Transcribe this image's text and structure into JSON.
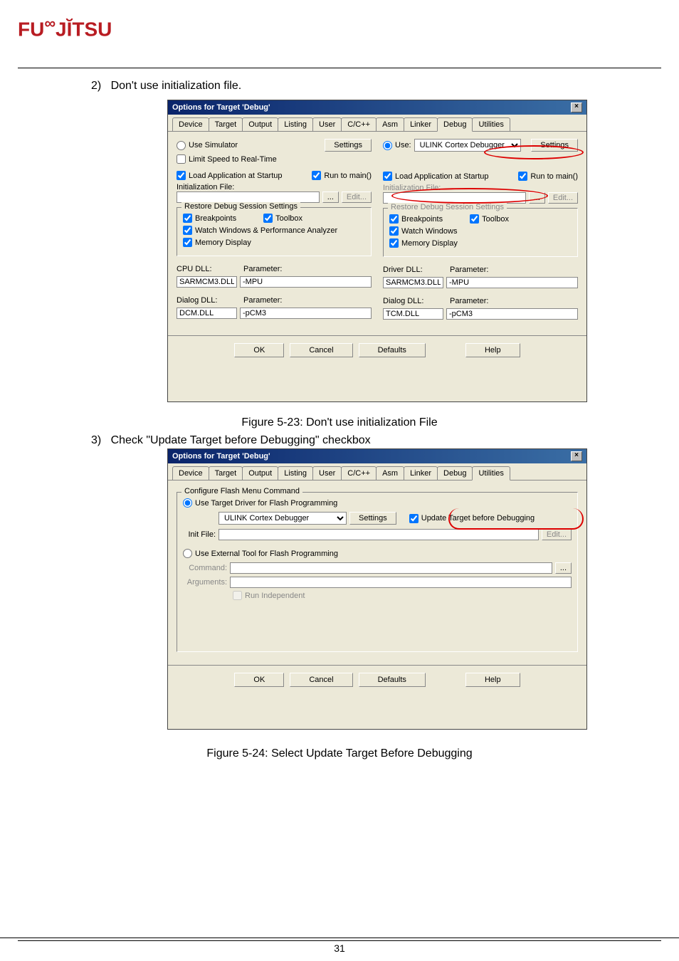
{
  "logo": "FUJITSU",
  "step2": {
    "num": "2)",
    "text": "Don't use initialization file."
  },
  "caption1": "Figure 5-23:  Don't use initialization File",
  "step3": {
    "num": "3)",
    "text": "Check \"Update Target before Debugging\" checkbox"
  },
  "caption2": "Figure 5-24:  Select Update Target Before Debugging",
  "page_number": "31",
  "dialog1": {
    "title": "Options for Target 'Debug'",
    "tabs": [
      "Device",
      "Target",
      "Output",
      "Listing",
      "User",
      "C/C++",
      "Asm",
      "Linker",
      "Debug",
      "Utilities"
    ],
    "active_tab": 8,
    "left": {
      "use_simulator": "Use Simulator",
      "settings": "Settings",
      "limit_speed": "Limit Speed to Real-Time",
      "load_app": "Load Application at Startup",
      "run_to_main": "Run to main()",
      "init_file_label": "Initialization File:",
      "init_file_value": "",
      "browse": "...",
      "edit": "Edit...",
      "restore_legend": "Restore Debug Session Settings",
      "breakpoints": "Breakpoints",
      "toolbox": "Toolbox",
      "watch": "Watch Windows & Performance Analyzer",
      "memory": "Memory Display",
      "cpu_dll_label": "CPU DLL:",
      "cpu_dll_value": "SARMCM3.DLL",
      "param_label": "Parameter:",
      "cpu_param_value": "-MPU",
      "dialog_dll_label": "Dialog DLL:",
      "dialog_dll_value": "DCM.DLL",
      "dialog_param_value": "-pCM3"
    },
    "right": {
      "use": "Use:",
      "debugger": "ULINK Cortex Debugger",
      "settings": "Settings",
      "load_app": "Load Application at Startup",
      "run_to_main": "Run to main()",
      "init_file_label": "Initialization File:",
      "init_file_value": "",
      "browse": "...",
      "edit": "Edit...",
      "restore_legend": "Restore Debug Session Settings",
      "breakpoints": "Breakpoints",
      "toolbox": "Toolbox",
      "watch": "Watch Windows",
      "memory": "Memory Display",
      "driver_dll_label": "Driver DLL:",
      "driver_dll_value": "SARMCM3.DLL",
      "param_label": "Parameter:",
      "driver_param_value": "-MPU",
      "dialog_dll_label": "Dialog DLL:",
      "dialog_dll_value": "TCM.DLL",
      "dialog_param_value": "-pCM3"
    },
    "buttons": {
      "ok": "OK",
      "cancel": "Cancel",
      "defaults": "Defaults",
      "help": "Help"
    }
  },
  "dialog2": {
    "title": "Options for Target 'Debug'",
    "tabs": [
      "Device",
      "Target",
      "Output",
      "Listing",
      "User",
      "C/C++",
      "Asm",
      "Linker",
      "Debug",
      "Utilities"
    ],
    "active_tab": 9,
    "legend": "Configure Flash Menu Command",
    "use_target_driver": "Use Target Driver for Flash Programming",
    "debugger": "ULINK Cortex Debugger",
    "settings": "Settings",
    "update_target": "Update Target before Debugging",
    "init_file_label": "Init File:",
    "init_file_value": "",
    "edit": "Edit...",
    "use_external": "Use External Tool for Flash Programming",
    "command_label": "Command:",
    "command_value": "",
    "browse": "...",
    "arguments_label": "Arguments:",
    "arguments_value": "",
    "run_independent": "Run Independent",
    "buttons": {
      "ok": "OK",
      "cancel": "Cancel",
      "defaults": "Defaults",
      "help": "Help"
    }
  }
}
